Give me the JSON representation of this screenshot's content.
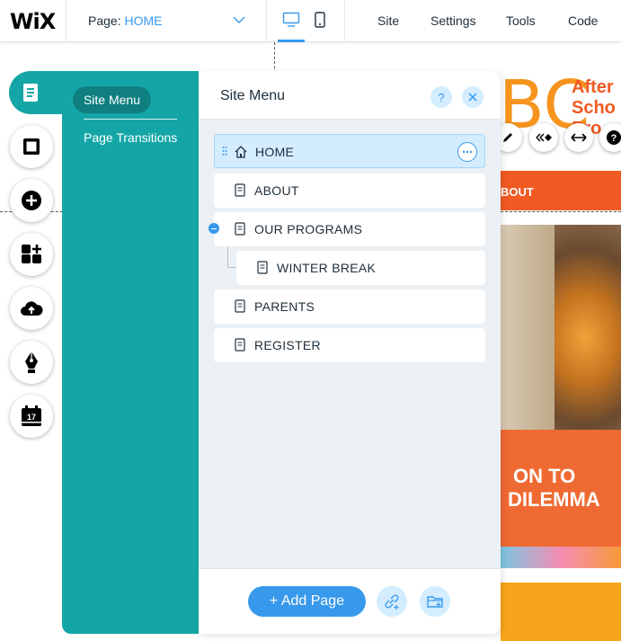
{
  "topbar": {
    "logo": "WiX",
    "page_label": "Page:",
    "page_value": "HOME",
    "menu": [
      "Site",
      "Settings",
      "Tools",
      "Code"
    ]
  },
  "site_preview": {
    "logo_letters": "BC",
    "logo_lines": [
      "After",
      "Scho",
      "Pro"
    ],
    "nav_text": "BOUT",
    "banner_line1": "ON TO",
    "banner_line2": "DILEMMA",
    "tool_icons": [
      "pen-icon",
      "animation-icon",
      "stretch-icon",
      "help-icon"
    ]
  },
  "left_rail": {
    "items": [
      "pages-icon",
      "background-icon",
      "add-icon",
      "add-apps-icon",
      "upload-icon",
      "blog-icon",
      "bookings-icon"
    ],
    "calendar_number": "17"
  },
  "side_tabs": {
    "site_menu": "Site Menu",
    "page_transitions": "Page Transitions"
  },
  "panel": {
    "title": "Site Menu",
    "help": "?",
    "pages": [
      {
        "label": "HOME",
        "selected": true
      },
      {
        "label": "ABOUT"
      },
      {
        "label": "OUR PROGRAMS",
        "expanded": true
      },
      {
        "label": "WINTER BREAK",
        "subpage": true
      },
      {
        "label": "PARENTS"
      },
      {
        "label": "REGISTER"
      }
    ],
    "add_page": "+ Add Page"
  },
  "colors": {
    "accent": "#3899ec",
    "teal": "#14a6a6",
    "site_orange": "#f15a22"
  }
}
